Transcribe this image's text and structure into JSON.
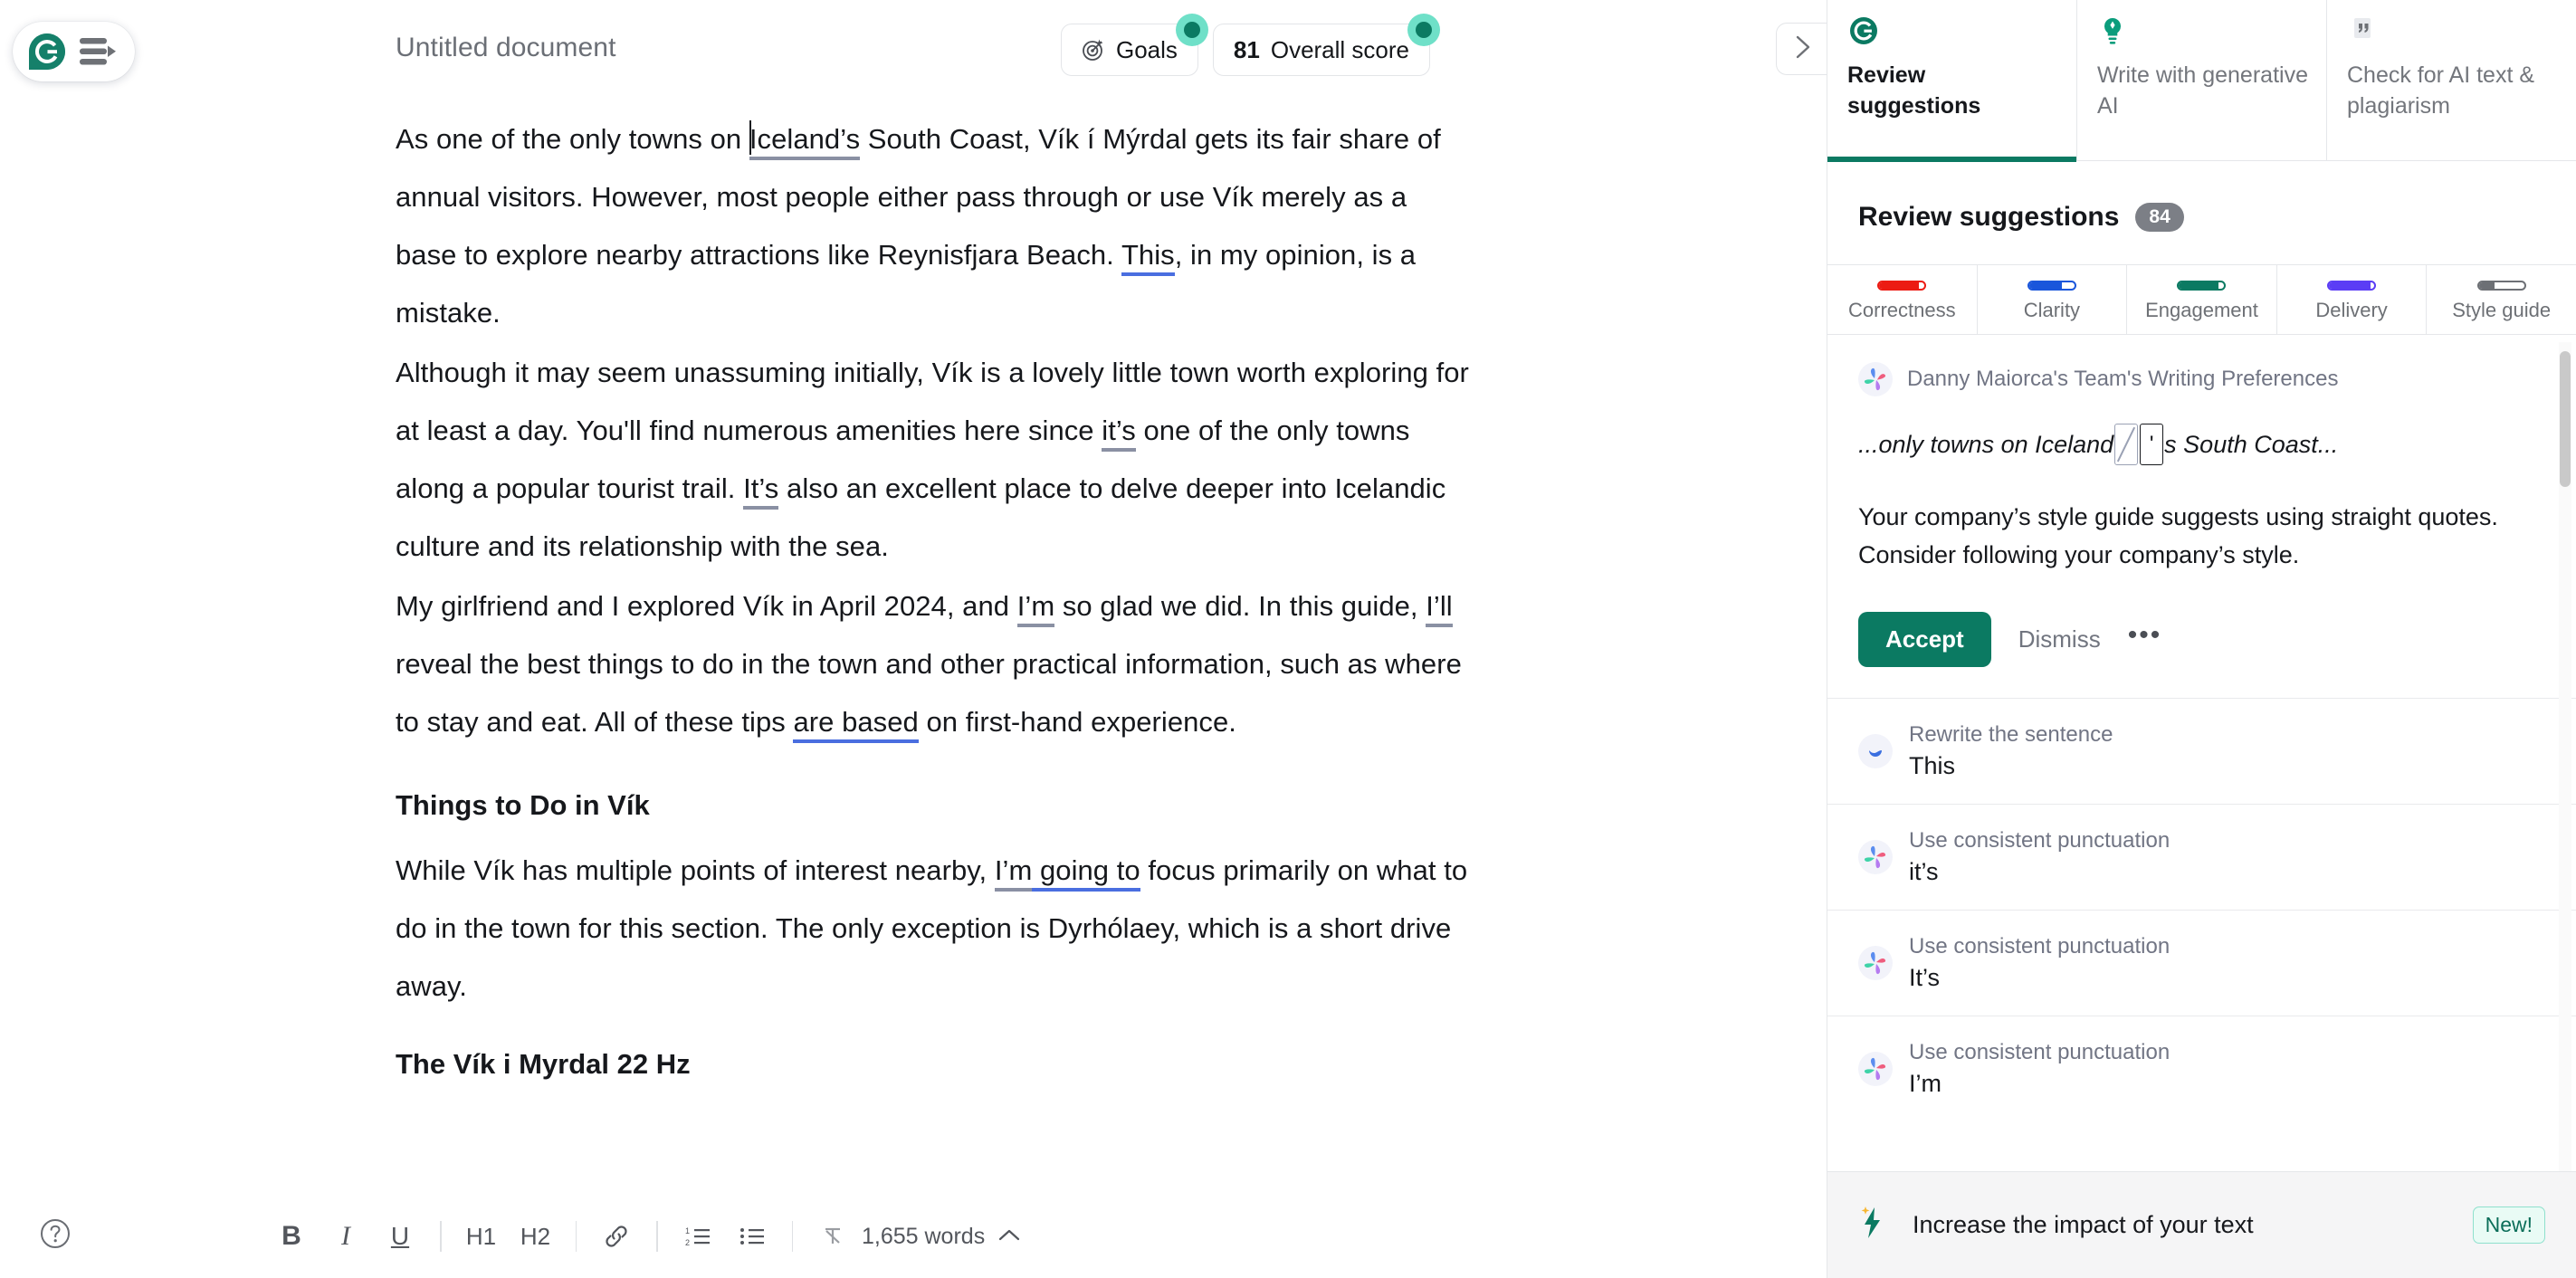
{
  "app": {
    "logo_icon": "grammarly-g-logo",
    "sidebar_toggle_icon": "hamburger-arrow-icon"
  },
  "header": {
    "doc_title": "Untitled document",
    "goals": {
      "label": "Goals",
      "icon": "target-goal-icon",
      "badge_color": "#6fe0c8"
    },
    "score": {
      "value": "81",
      "label": "Overall score",
      "badge_color": "#6fe0c8"
    },
    "collapse_icon": "chevron-right-icon"
  },
  "document": {
    "paragraphs": [
      {
        "runs": [
          {
            "t": "As one of the only towns on ",
            "mark": "none"
          },
          {
            "t": "Iceland’s",
            "mark": "style"
          },
          {
            "t": " South Coast, Vík í Mýrdal gets its fair share of annual visitors. However, most people either pass through or use Vík merely as a base to explore nearby attractions like Reynisfjara Beach. ",
            "mark": "none"
          },
          {
            "t": "This",
            "mark": "clarity"
          },
          {
            "t": ", in my opinion, is a mistake.",
            "mark": "none"
          }
        ]
      },
      {
        "runs": [
          {
            "t": "Although it may seem unassuming initially, Vík is a lovely little town worth exploring for at least a day. You'll find numerous amenities here since ",
            "mark": "none"
          },
          {
            "t": "it’s",
            "mark": "style"
          },
          {
            "t": " one of the only towns along a popular tourist trail. ",
            "mark": "none"
          },
          {
            "t": "It’s",
            "mark": "style"
          },
          {
            "t": " also an excellent place to delve deeper into Icelandic culture and its relationship with the sea.",
            "mark": "none"
          }
        ]
      },
      {
        "runs": [
          {
            "t": "My girlfriend and I explored Vík in April 2024, and ",
            "mark": "none"
          },
          {
            "t": "I’m",
            "mark": "style"
          },
          {
            "t": " so glad we did. In this guide, ",
            "mark": "none"
          },
          {
            "t": "I’ll",
            "mark": "style"
          },
          {
            "t": " reveal the best things to do in the town and other practical information, such as where to stay and eat. All of these tips ",
            "mark": "none"
          },
          {
            "t": "are based",
            "mark": "clarity"
          },
          {
            "t": " on first-hand experience.",
            "mark": "none"
          }
        ]
      }
    ],
    "heading": "Things to Do in Vík",
    "after_heading": {
      "runs": [
        {
          "t": "While Vík has multiple points of interest nearby, ",
          "mark": "none"
        },
        {
          "t": "I’m",
          "mark": "style"
        },
        {
          "t": " going to",
          "mark": "clarity"
        },
        {
          "t": " focus primarily on what to do in the town for this section. The only exception is Dyrhólaey, which is a short drive away.",
          "mark": "none"
        }
      ]
    },
    "clipped_heading": "The Vík i Myrdal 22 Hz"
  },
  "toolbar": {
    "help_icon": "question-circle-icon",
    "buttons": [
      {
        "name": "bold",
        "glyph": "B",
        "title": "Bold"
      },
      {
        "name": "italic",
        "glyph": "I",
        "title": "Italic"
      },
      {
        "name": "underline",
        "glyph": "U",
        "title": "Underline"
      },
      {
        "name": "heading-1",
        "glyph": "H1",
        "title": "Heading 1"
      },
      {
        "name": "heading-2",
        "glyph": "H2",
        "title": "Heading 2"
      },
      {
        "name": "link",
        "glyph": "link-icon",
        "title": "Link"
      },
      {
        "name": "numbered-list",
        "glyph": "ordered-list-icon",
        "title": "Numbered list"
      },
      {
        "name": "bulleted-list",
        "glyph": "bullet-list-icon",
        "title": "Bulleted list"
      },
      {
        "name": "clear-formatting",
        "glyph": "clear-format-icon",
        "title": "Clear formatting"
      }
    ],
    "word_count": "1,655 words",
    "word_count_chevron": "chevron-up-icon"
  },
  "sidebar": {
    "tabs": [
      {
        "label": "Review suggestions",
        "icon": "grammarly-g-icon",
        "active": true
      },
      {
        "label": "Write with generative AI",
        "icon": "lightbulb-icon",
        "active": false
      },
      {
        "label": "Check for AI text & plagiarism",
        "icon": "quote-page-icon",
        "active": false
      }
    ],
    "panel_title": "Review suggestions",
    "panel_count": "84",
    "categories": [
      {
        "name": "Correctness",
        "color": "#ec1b13",
        "fill": 88
      },
      {
        "name": "Clarity",
        "color": "#1a56db",
        "fill": 72
      },
      {
        "name": "Engagement",
        "color": "#0b7a62",
        "fill": 87
      },
      {
        "name": "Delivery",
        "color": "#5b3df5",
        "fill": 92
      },
      {
        "name": "Style guide",
        "color": "#6d7075",
        "fill": 34
      }
    ],
    "main_card": {
      "source_icon": "style-guide-flower-icon",
      "source_label": "Danny Maiorca's Team's Writing Preferences",
      "quote_prefix": "...only towns on Iceland",
      "quote_deleted": "’",
      "quote_inserted": "'",
      "quote_suffix": "s South Coast...",
      "description": "Your company’s style guide suggests using straight quotes. Consider following your company’s style.",
      "accept_label": "Accept",
      "dismiss_label": "Dismiss",
      "more_label": "•••"
    },
    "suggestions": [
      {
        "icon": "clarity-drop-icon",
        "kind": "Rewrite the sentence",
        "text": "This"
      },
      {
        "icon": "style-guide-flower-icon",
        "kind": "Use consistent punctuation",
        "text": "it’s"
      },
      {
        "icon": "style-guide-flower-icon",
        "kind": "Use consistent punctuation",
        "text": "It’s"
      },
      {
        "icon": "style-guide-flower-icon",
        "kind": "Use consistent punctuation",
        "text": "I’m"
      }
    ],
    "impact_banner": {
      "icon": "lightning-bolt-icon",
      "text": "Increase the impact of your text",
      "badge": "New!"
    }
  }
}
